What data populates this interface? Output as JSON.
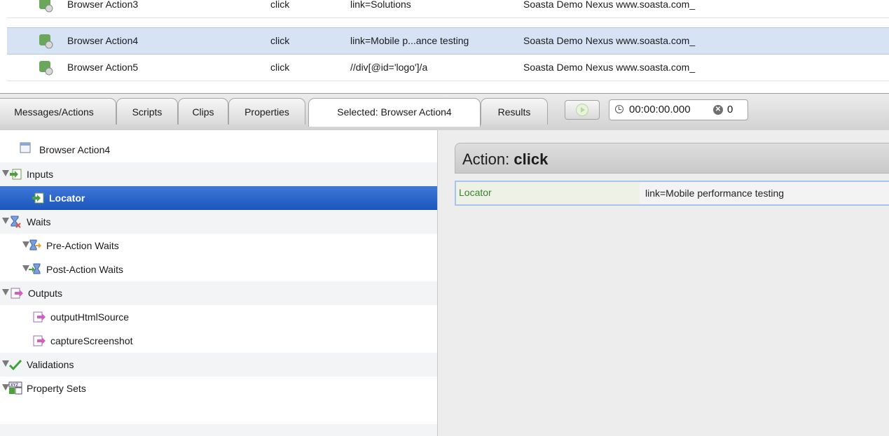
{
  "table": {
    "rows": [
      {
        "name": "Browser Action3",
        "type": "click",
        "locator": "link=Solutions",
        "window": "Soasta Demo Nexus www.soasta.com_"
      },
      {
        "name": "Browser Action4",
        "type": "click",
        "locator": "link=Mobile p...ance testing",
        "window": "Soasta Demo Nexus www.soasta.com_"
      },
      {
        "name": "Browser Action5",
        "type": "click",
        "locator": "//div[@id='logo']/a",
        "window": "Soasta Demo Nexus www.soasta.com_"
      }
    ]
  },
  "tabs": {
    "messages": "Messages/Actions",
    "scripts": "Scripts",
    "clips": "Clips",
    "properties": "Properties",
    "selected": "Selected: Browser Action4",
    "results": "Results"
  },
  "timer": {
    "time": "00:00:00.000",
    "errors": "0"
  },
  "tree": {
    "root": "Browser Action4",
    "inputs": "Inputs",
    "locator": "Locator",
    "waits": "Waits",
    "pre_waits": "Pre-Action Waits",
    "post_waits": "Post-Action Waits",
    "outputs": "Outputs",
    "output_html": "outputHtmlSource",
    "capture": "captureScreenshot",
    "validations": "Validations",
    "property_sets": "Property Sets"
  },
  "detail": {
    "action_prefix": "Action: ",
    "action_name": "click",
    "prop_name": "Locator",
    "prop_value": "link=Mobile performance testing"
  },
  "colors": {
    "selection": "#d6e3f5",
    "tree_selected": "#2a62c8",
    "locator_label": "#3d7f2e"
  },
  "icons": [
    "browser-action-icon",
    "inputs-icon",
    "waits-icon",
    "outputs-icon",
    "validation-check-icon",
    "property-sets-icon",
    "clock-icon",
    "error-icon",
    "play-icon"
  ]
}
